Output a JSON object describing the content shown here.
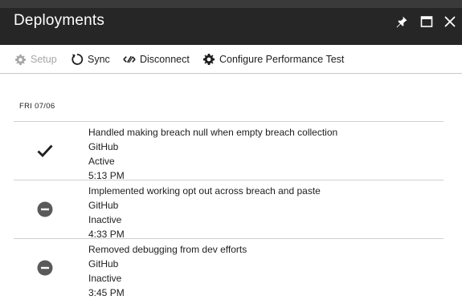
{
  "window": {
    "title": "Deployments"
  },
  "toolbar": {
    "setup_label": "Setup",
    "sync_label": "Sync",
    "disconnect_label": "Disconnect",
    "perf_label": "Configure Performance Test"
  },
  "date_header": "FRI 07/06",
  "deployments": [
    {
      "message": "Handled making breach null when empty breach collection",
      "source": "GitHub",
      "status": "Active",
      "time": "5:13 PM",
      "icon": "checkmark-icon"
    },
    {
      "message": "Implemented working opt out across breach and paste",
      "source": "GitHub",
      "status": "Inactive",
      "time": "4:33 PM",
      "icon": "inactive-icon"
    },
    {
      "message": "Removed debugging from dev efforts",
      "source": "GitHub",
      "status": "Inactive",
      "time": "3:45 PM",
      "icon": "inactive-icon"
    }
  ],
  "colors": {
    "titlebar": "#262626",
    "inactive_icon": "#5a5a5a",
    "disabled_text": "#a6a6a6"
  }
}
